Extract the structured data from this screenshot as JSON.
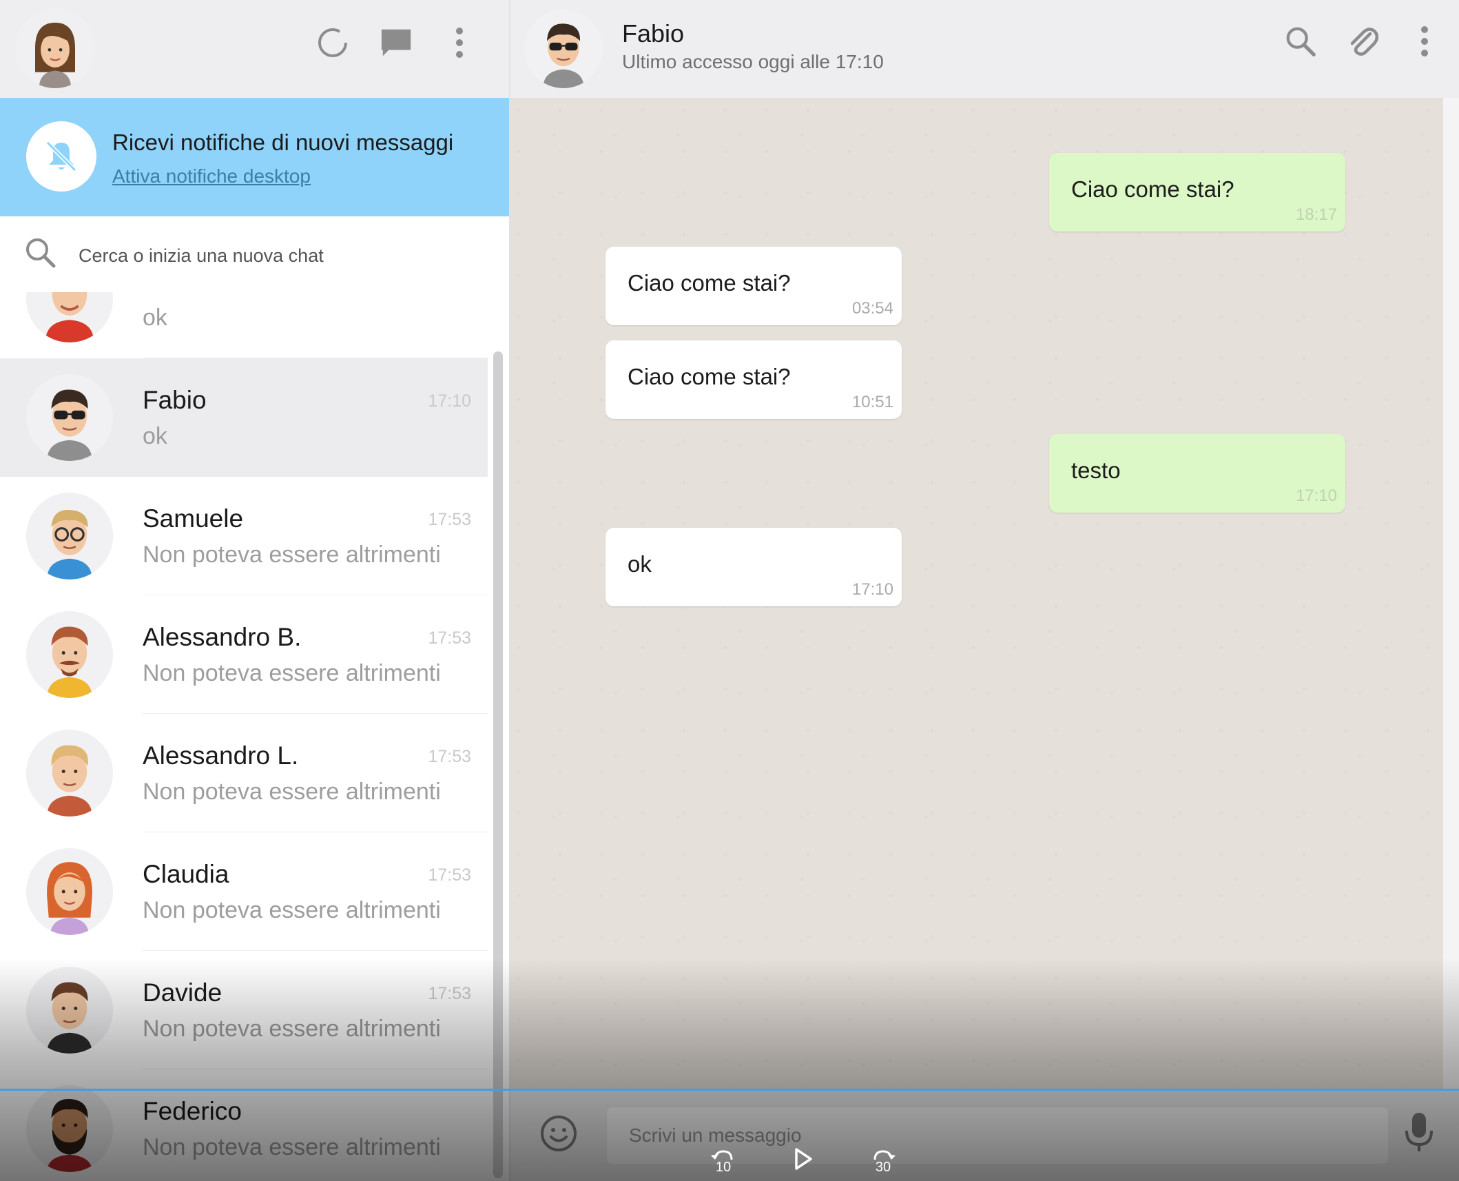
{
  "left_header": {
    "user_avatar": "woman-avatar",
    "icons": [
      "status-icon",
      "new-chat-icon",
      "menu-icon"
    ]
  },
  "notification_banner": {
    "title": "Ricevi notifiche di nuovi messaggi",
    "link": "Attiva notifiche desktop",
    "icon": "bell-off-icon"
  },
  "search": {
    "placeholder": "Cerca o inizia una nuova chat"
  },
  "chats": [
    {
      "name": "",
      "time": "",
      "last_message": "ok",
      "avatar": "red-shirt-avatar"
    },
    {
      "name": "Fabio",
      "time": "17:10",
      "last_message": "ok",
      "avatar": "sunglasses-avatar"
    },
    {
      "name": "Samuele",
      "time": "17:53",
      "last_message": "Non poteva essere altrimenti",
      "avatar": "glasses-avatar"
    },
    {
      "name": "Alessandro B.",
      "time": "17:53",
      "last_message": "Non poteva essere altrimenti",
      "avatar": "mustache-avatar"
    },
    {
      "name": "Alessandro L.",
      "time": "17:53",
      "last_message": "Non poteva essere altrimenti",
      "avatar": "blond-avatar"
    },
    {
      "name": "Claudia",
      "time": "17:53",
      "last_message": "Non poteva essere altrimenti",
      "avatar": "redhead-avatar"
    },
    {
      "name": "Davide",
      "time": "17:53",
      "last_message": "Non poteva essere altrimenti",
      "avatar": "brown-hair-avatar"
    },
    {
      "name": "Federico",
      "time": "",
      "last_message": "Non poteva essere altrimenti",
      "avatar": "beard-avatar"
    }
  ],
  "conversation": {
    "contact_name": "Fabio",
    "contact_status": "Ultimo accesso oggi alle 17:10",
    "icons": [
      "search-icon",
      "attach-icon",
      "menu-icon"
    ]
  },
  "messages": [
    {
      "direction": "out",
      "text": "Ciao come stai?",
      "time": "18:17"
    },
    {
      "direction": "in",
      "text": "Ciao come stai?",
      "time": "03:54"
    },
    {
      "direction": "in",
      "text": "Ciao come stai?",
      "time": "10:51"
    },
    {
      "direction": "out",
      "text": "testo",
      "time": "17:10"
    },
    {
      "direction": "in",
      "text": "ok",
      "time": "17:10"
    }
  ],
  "composer": {
    "placeholder": "Scrivi un messaggio"
  },
  "player": {
    "rewind_label": "10",
    "forward_label": "30"
  },
  "colors": {
    "banner": "#8fd3fa",
    "outgoing_bubble": "#dcf8c6",
    "incoming_bubble": "#ffffff",
    "chat_background": "#e6e0da",
    "progress": "#4a9bd8"
  }
}
